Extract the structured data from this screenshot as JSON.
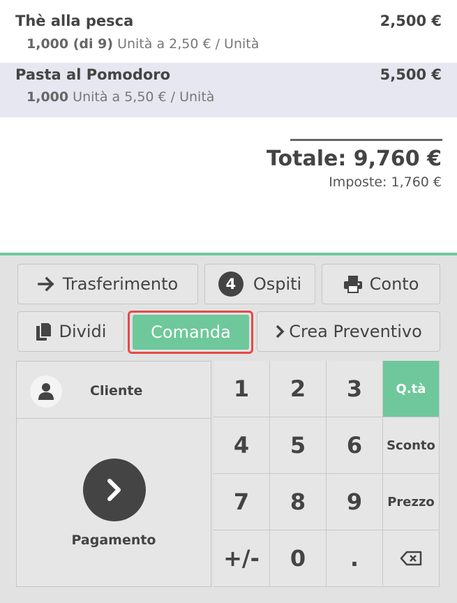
{
  "order": {
    "lines": [
      {
        "name": "Thè alla pesca",
        "price": "2,500 €",
        "qty": "1,000 (di 9)",
        "unit_info": "Unità a 2,50 € / Unità"
      },
      {
        "name": "Pasta al Pomodoro",
        "price": "5,500 €",
        "qty": "1,000",
        "unit_info": "Unità a 5,50 € / Unità"
      }
    ],
    "total": "Totale: 9,760 €",
    "taxes": "Imposte: 1,760 €"
  },
  "controls": {
    "transfer": "Trasferimento",
    "guests_count": "4",
    "guests": "Ospiti",
    "bill": "Conto",
    "split": "Dividi",
    "order": "Comanda",
    "quote": "Crea Preventivo"
  },
  "actionpad": {
    "customer": "Cliente",
    "payment": "Pagamento"
  },
  "numpad": {
    "keys": [
      "1",
      "2",
      "3",
      "4",
      "5",
      "6",
      "7",
      "8",
      "9",
      "+/-",
      "0",
      "."
    ],
    "modes": [
      "Q.tà",
      "Sconto",
      "Prezzo"
    ],
    "active_mode": "Q.tà"
  },
  "colors": {
    "accent": "#6ec89b",
    "highlight_border": "#e44a4a",
    "selected_line": "#e6e7f0"
  }
}
